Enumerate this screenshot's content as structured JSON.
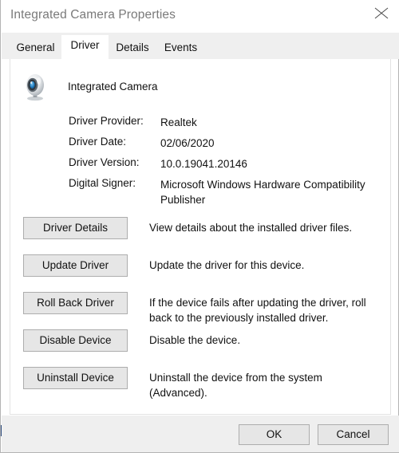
{
  "window": {
    "title": "Integrated Camera Properties",
    "close_icon": "close-icon"
  },
  "tabs": [
    {
      "label": "General",
      "selected": false
    },
    {
      "label": "Driver",
      "selected": true
    },
    {
      "label": "Details",
      "selected": false
    },
    {
      "label": "Events",
      "selected": false
    }
  ],
  "device": {
    "name": "Integrated Camera",
    "icon": "webcam-icon"
  },
  "info": [
    {
      "label": "Driver Provider:",
      "value": "Realtek"
    },
    {
      "label": "Driver Date:",
      "value": "02/06/2020"
    },
    {
      "label": "Driver Version:",
      "value": "10.0.19041.20146"
    },
    {
      "label": "Digital Signer:",
      "value": "Microsoft Windows Hardware Compatibility Publisher"
    }
  ],
  "actions": [
    {
      "button": "Driver Details",
      "description": "View details about the installed driver files."
    },
    {
      "button": "Update Driver",
      "description": "Update the driver for this device."
    },
    {
      "button": "Roll Back Driver",
      "description": "If the device fails after updating the driver, roll back to the previously installed driver."
    },
    {
      "button": "Disable Device",
      "description": "Disable the device."
    },
    {
      "button": "Uninstall Device",
      "description": "Uninstall the device from the system (Advanced)."
    }
  ],
  "footer": {
    "ok_label": "OK",
    "cancel_label": "Cancel"
  },
  "colors": {
    "dialog_background": "#ffffff",
    "chrome_background": "#efefef",
    "button_face": "#e6e6e6",
    "button_border": "#adadad",
    "title_text": "#7a7a7a",
    "body_text": "#111111",
    "accent_mark": "#2b4a7d"
  }
}
